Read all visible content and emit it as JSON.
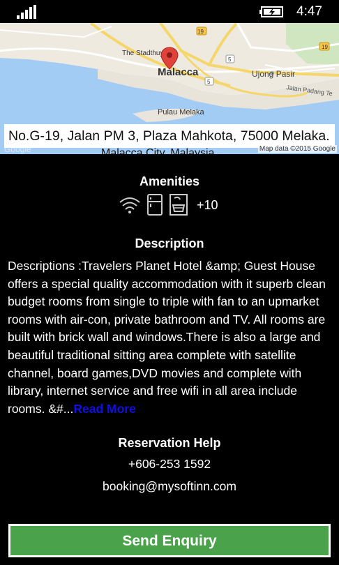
{
  "status_bar": {
    "time": "4:47",
    "signal_icon": "signal-strength-icon",
    "battery_icon": "battery-charging-icon"
  },
  "map": {
    "labels": {
      "city": "Malacca",
      "stadthuys": "The Stadthuys",
      "ujong_pasir": "Ujong Pasir",
      "jalan_padang": "Jalan Padang Te",
      "pulau_melaka": "Pulau Melaka",
      "route_19": "19",
      "route_19b": "19",
      "route_5": "5",
      "route_5b": "5",
      "google": "Google"
    },
    "pin_icon": "map-pin-icon",
    "address": "No.G-19, Jalan PM 3, Plaza Mahkota, 75000 Melaka.",
    "address_line2": "Malacca City, Malaysia",
    "credit": "Map data ©2015 Google"
  },
  "amenities": {
    "title": "Amenities",
    "icons": [
      "wifi-icon",
      "refrigerator-icon",
      "bathtub-icon"
    ],
    "more": "+10"
  },
  "description": {
    "title": "Description",
    "text": "Descriptions :Travelers Planet Hotel &amp; Guest House offers a special quality accommodation with it superb clean budget rooms from single to triple with fan to an upmarket rooms with air-con, private bathroom and TV. All rooms are built with brick wall and windows.There is also a large and beautiful traditional sitting area complete with satellite channel, board games,DVD movies and complete with library, internet service and free wifi in all area include rooms. &#...",
    "read_more": "Read More"
  },
  "reservation": {
    "title": "Reservation Help",
    "phone": "+606-253 1592",
    "email": "booking@mysoftinn.com"
  },
  "enquiry_button": "Send Enquiry",
  "colors": {
    "button": "#4aa24a",
    "read_more": "#1010e0",
    "background": "#000000"
  }
}
